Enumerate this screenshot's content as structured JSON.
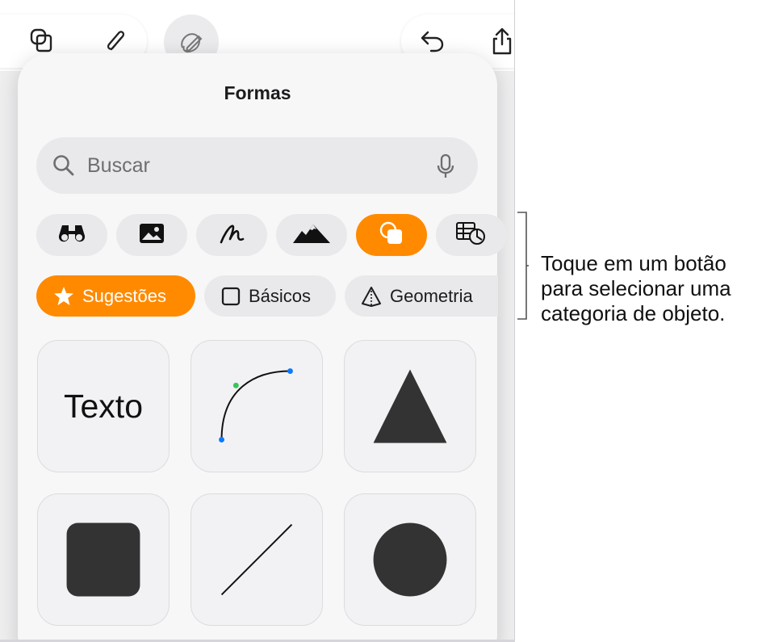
{
  "popover": {
    "title": "Formas",
    "search": {
      "placeholder": "Buscar"
    }
  },
  "toolbar": {
    "left_icons": [
      "copy-shapes-icon",
      "paperclip-icon"
    ],
    "middle_icon": "pencil-markup-icon",
    "right_icons": [
      "undo-icon",
      "share-icon"
    ]
  },
  "category_buttons": [
    {
      "icon": "binoculars-icon",
      "selected": false
    },
    {
      "icon": "photo-icon",
      "selected": false
    },
    {
      "icon": "scribble-icon",
      "selected": false
    },
    {
      "icon": "mountains-icon",
      "selected": false
    },
    {
      "icon": "shapes-icon",
      "selected": true
    },
    {
      "icon": "table-chart-icon",
      "selected": false
    }
  ],
  "tabs": [
    {
      "label": "Sugestões",
      "icon": "star-icon",
      "selected": true
    },
    {
      "label": "Básicos",
      "icon": "square-outline-icon",
      "selected": false
    },
    {
      "label": "Geometria",
      "icon": "pyramid-icon",
      "selected": false
    }
  ],
  "shapes": [
    {
      "name": "text",
      "label": "Texto"
    },
    {
      "name": "curve"
    },
    {
      "name": "triangle"
    },
    {
      "name": "rounded-square"
    },
    {
      "name": "line"
    },
    {
      "name": "circle"
    }
  ],
  "callout": {
    "lines": [
      "Toque em um botão",
      "para selecionar uma",
      "categoria de objeto."
    ]
  },
  "colors": {
    "accent": "#ff8a00",
    "shape_fill": "#333333",
    "curve_point_green": "#34c759",
    "curve_point_blue": "#0a7aff"
  }
}
